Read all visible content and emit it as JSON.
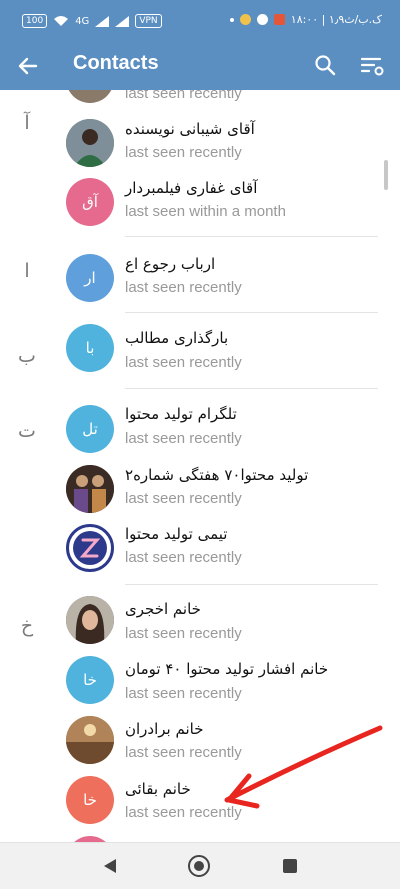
{
  "status_bar": {
    "battery": "100",
    "network": "4G",
    "vpn": "VPN",
    "time": "۱۸:۰۰ | ۱٫۹ک.ب/ث"
  },
  "appbar": {
    "title": "Contacts"
  },
  "sections": [
    {
      "letter": ""
    },
    {
      "letter": "آ"
    },
    {
      "letter": "ا"
    },
    {
      "letter": "ب"
    },
    {
      "letter": "ت"
    },
    {
      "letter": "خ"
    }
  ],
  "contacts": [
    {
      "name": "",
      "status": "last seen recently",
      "avatar_text": "",
      "avatar_color": "#8a7a6a"
    },
    {
      "name": "آقای شیبانی نویسنده",
      "status": "last seen recently",
      "avatar_text": "",
      "avatar_color": "#4e6b4a"
    },
    {
      "name": "آقای غفاری فیلمبردار",
      "status": "last seen within a month",
      "avatar_text": "آق",
      "avatar_color": "#e56a8e"
    },
    {
      "name": "ارباب رجوع اع",
      "status": "last seen recently",
      "avatar_text": "ار",
      "avatar_color": "#5e9fdc"
    },
    {
      "name": "بارگذاری مطالب",
      "status": "last seen recently",
      "avatar_text": "با",
      "avatar_color": "#4fb3dd"
    },
    {
      "name": "تلگرام تولید محتوا",
      "status": "last seen recently",
      "avatar_text": "تل",
      "avatar_color": "#4fb3dd"
    },
    {
      "name": "تولید محتوا۷۰ هفتگی شماره۲",
      "status": "last seen recently",
      "avatar_text": "",
      "avatar_color": "#6b4a36"
    },
    {
      "name": "تیمی تولید محتوا",
      "status": "last seen recently",
      "avatar_text": "",
      "avatar_color": "#2d3a8c"
    },
    {
      "name": "خانم اخجری",
      "status": "last seen recently",
      "avatar_text": "",
      "avatar_color": "#5a4a42"
    },
    {
      "name": "خانم افشار تولید محتوا ۴۰ تومان",
      "status": "last seen recently",
      "avatar_text": "خا",
      "avatar_color": "#4fb3dd"
    },
    {
      "name": "خانم برادران",
      "status": "last seen recently",
      "avatar_text": "",
      "avatar_color": "#8a6a4a"
    },
    {
      "name": "خانم بقائی",
      "status": "last seen recently",
      "avatar_text": "خا",
      "avatar_color": "#ee6f5b"
    }
  ],
  "colors": {
    "header": "#5b8fc1",
    "annotation": "#e8251f"
  }
}
